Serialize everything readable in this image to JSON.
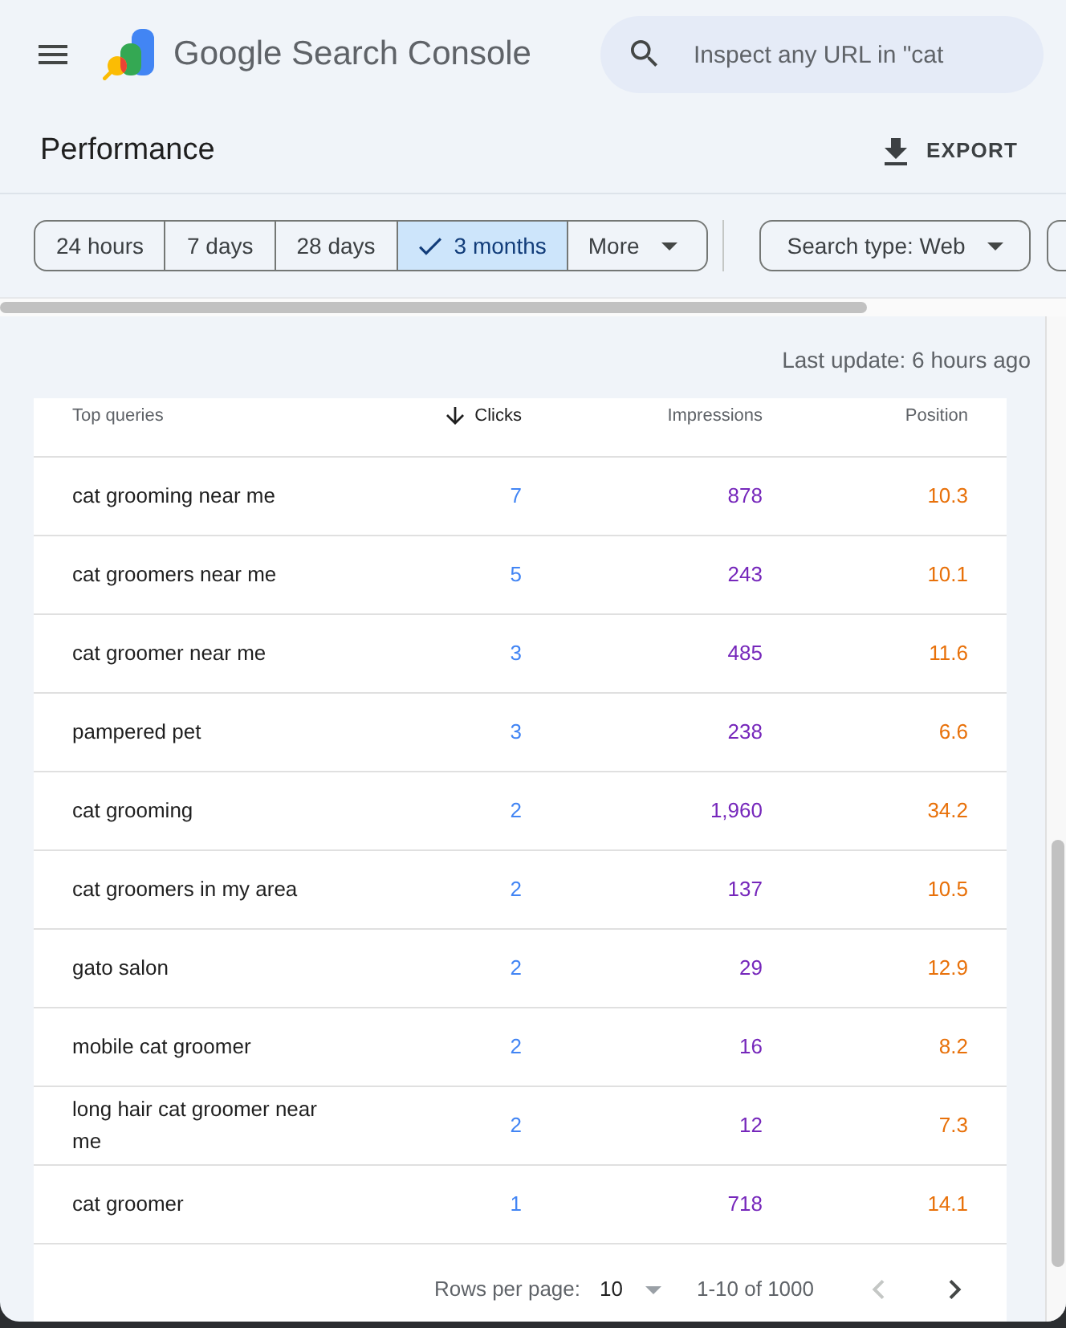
{
  "header": {
    "product_name": "Google Search Console",
    "search": {
      "placeholder": "Inspect any URL in \"cat"
    }
  },
  "page": {
    "title": "Performance",
    "export_label": "EXPORT"
  },
  "date_range": [
    {
      "label": "24 hours",
      "kind": "option",
      "selected": false
    },
    {
      "label": "7 days",
      "kind": "option",
      "selected": false
    },
    {
      "label": "28 days",
      "kind": "option",
      "selected": false
    },
    {
      "label": "3 months",
      "kind": "option",
      "selected": true
    },
    {
      "label": "More",
      "kind": "menu",
      "selected": false
    }
  ],
  "filters": [
    {
      "kind": "dropdown",
      "label": "Search type: Web"
    },
    {
      "kind": "cut_off"
    }
  ],
  "last_update": "Last update: 6 hours ago",
  "table": {
    "columns": [
      {
        "label": "Top queries",
        "sorted": false
      },
      {
        "label": "Clicks",
        "sorted": true,
        "color": "#4285f4"
      },
      {
        "label": "Impressions",
        "sorted": false,
        "color": "#7627bb"
      },
      {
        "label": "Position",
        "sorted": false,
        "color": "#e8710a"
      }
    ],
    "rows": [
      {
        "cells": [
          "cat grooming near me",
          "7",
          "878",
          "10.3"
        ]
      },
      {
        "cells": [
          "cat groomers near me",
          "5",
          "243",
          "10.1"
        ]
      },
      {
        "cells": [
          "cat groomer near me",
          "3",
          "485",
          "11.6"
        ]
      },
      {
        "cells": [
          "pampered pet",
          "3",
          "238",
          "6.6"
        ]
      },
      {
        "cells": [
          "cat grooming",
          "2",
          "1,960",
          "34.2"
        ]
      },
      {
        "cells": [
          "cat groomers in my area",
          "2",
          "137",
          "10.5"
        ]
      },
      {
        "cells": [
          "gato salon",
          "2",
          "29",
          "12.9"
        ]
      },
      {
        "cells": [
          "mobile cat groomer",
          "2",
          "16",
          "8.2"
        ]
      },
      {
        "cells": [
          "long hair cat groomer near me",
          "2",
          "12",
          "7.3"
        ]
      },
      {
        "cells": [
          "cat groomer",
          "1",
          "718",
          "14.1"
        ]
      }
    ],
    "pagination": {
      "rows_per_page_label": "Rows per page:",
      "rows_per_page": "10",
      "range": "1-10 of 1000",
      "previous": {
        "disabled": true
      },
      "next": {
        "disabled": false
      }
    }
  }
}
